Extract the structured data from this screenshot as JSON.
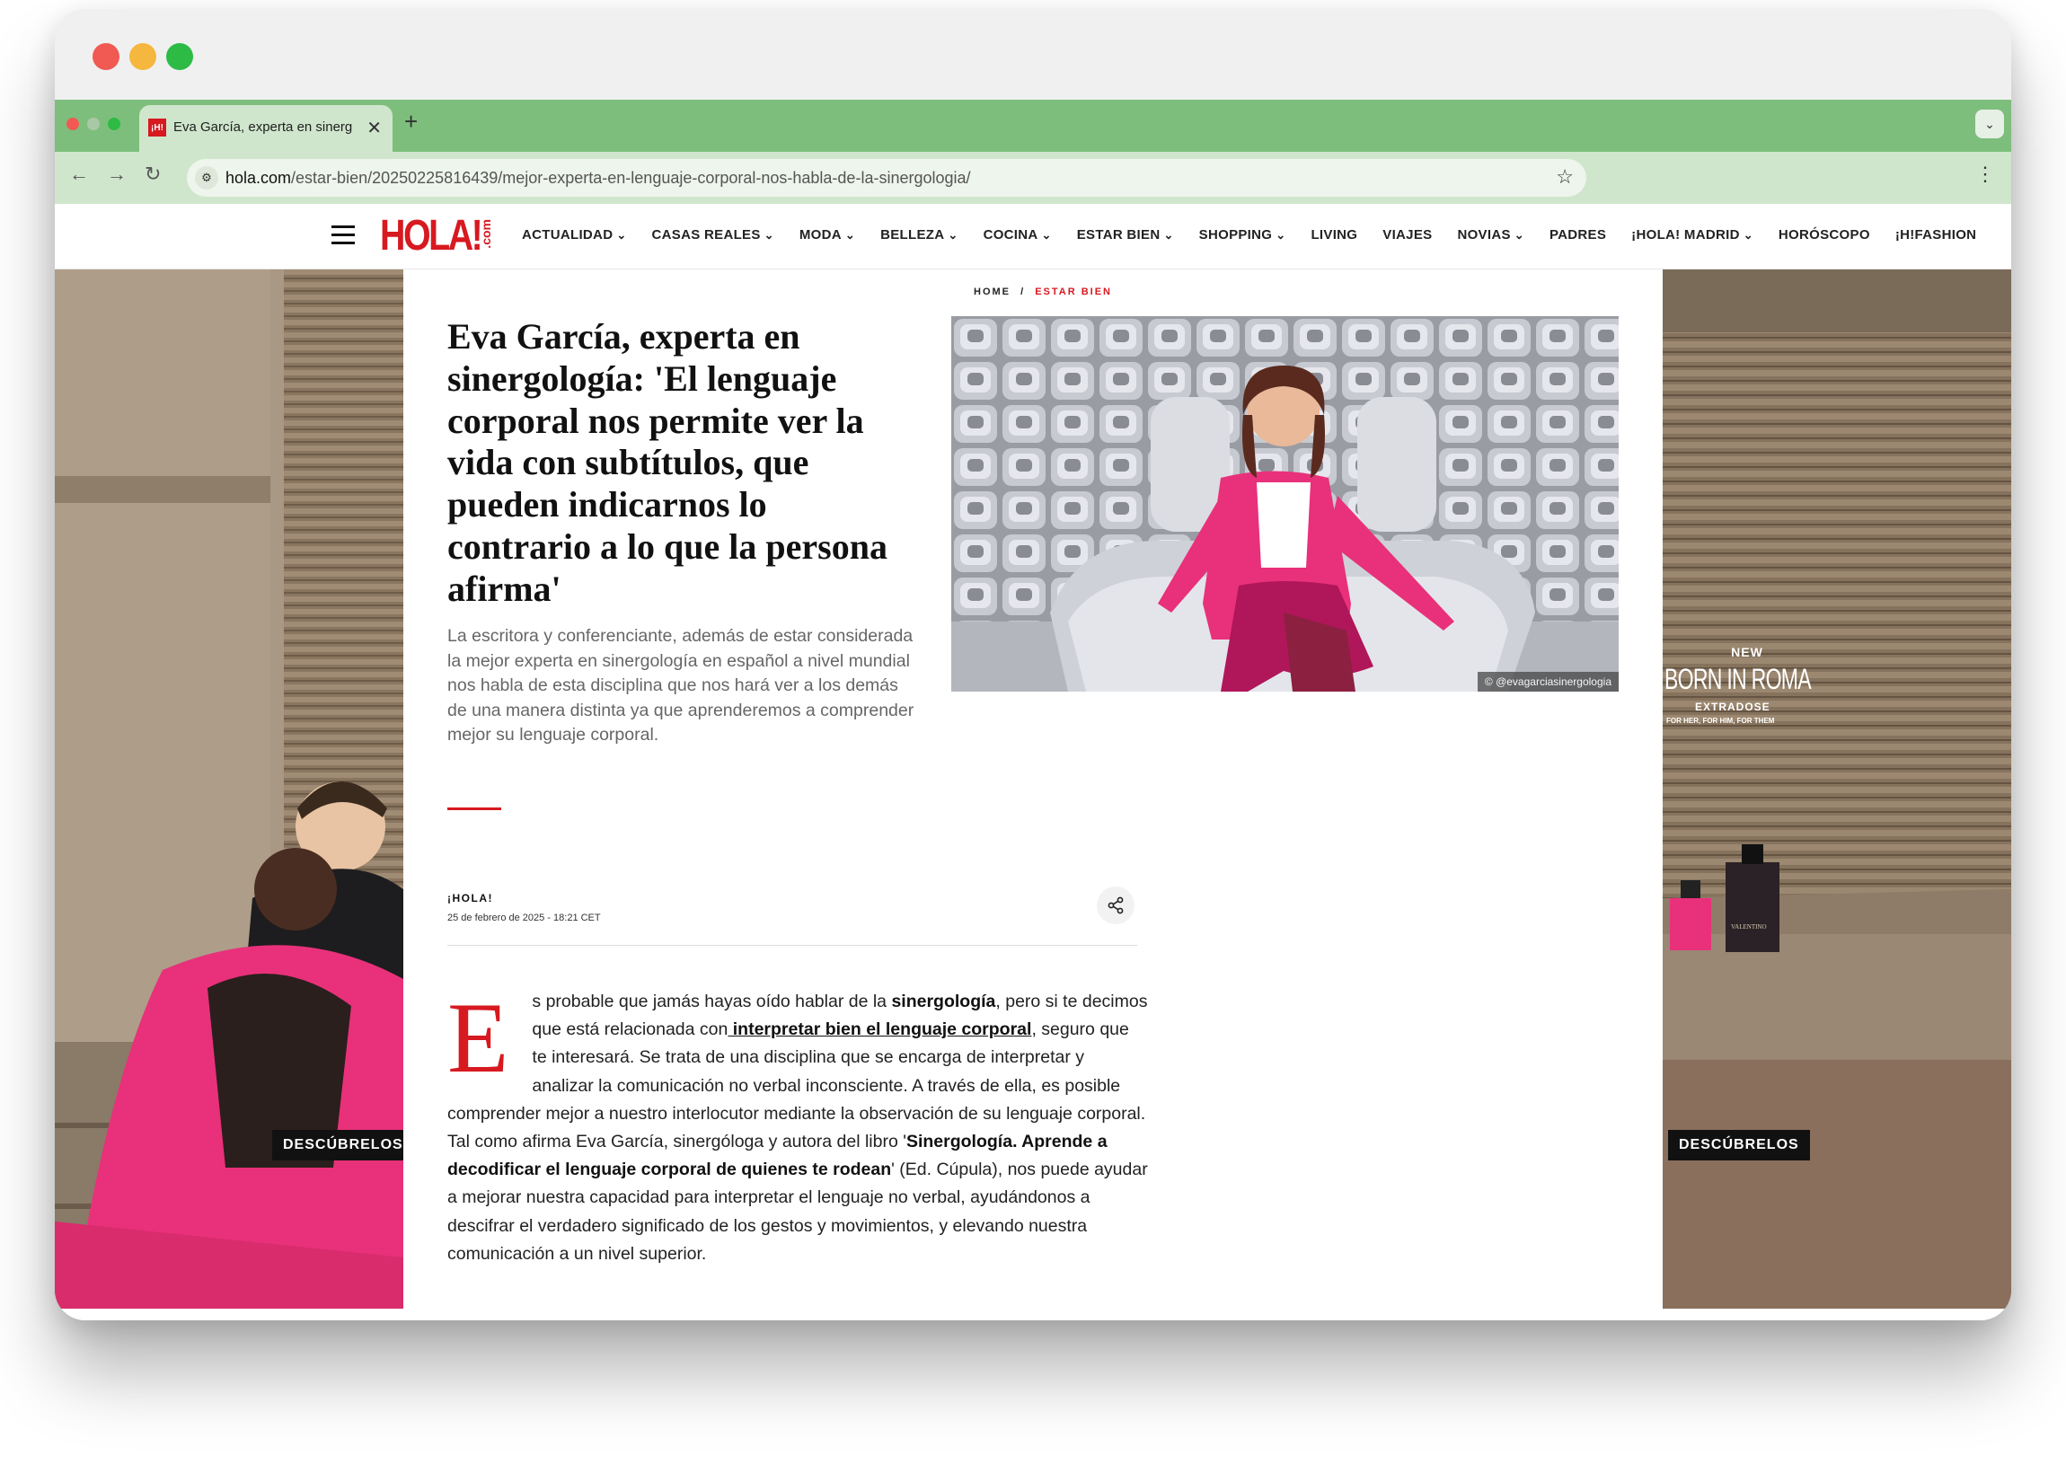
{
  "browser": {
    "tab_title": "Eva García, experta en sinerg",
    "favicon_text": "¡H!",
    "url_domain": "hola.com",
    "url_path": "/estar-bien/20250225816439/mejor-experta-en-lenguaje-corporal-nos-habla-de-la-sinergologia/"
  },
  "site": {
    "logo_text": "HOLA!",
    "logo_suffix": ".com",
    "nav": [
      "ACTUALIDAD",
      "CASAS REALES",
      "MODA",
      "BELLEZA",
      "COCINA",
      "ESTAR BIEN",
      "SHOPPING",
      "LIVING",
      "VIAJES",
      "NOVIAS",
      "PADRES",
      "¡HOLA! MADRID",
      "HORÓSCOPO",
      "¡H!FASHION"
    ],
    "nav_has_dropdown": [
      true,
      true,
      true,
      true,
      true,
      true,
      true,
      false,
      false,
      true,
      false,
      true,
      false,
      false
    ]
  },
  "ads": {
    "cta": "DESCÚBRELOS",
    "right_new": "NEW",
    "right_product": "BORN IN ROMA",
    "right_variant": "EXTRADOSE",
    "right_tagline": "FOR HER, FOR HIM, FOR THEM",
    "bottle_brand": "VALENTINO"
  },
  "article": {
    "breadcrumb_home": "HOME",
    "breadcrumb_sep": "/",
    "breadcrumb_section": "ESTAR BIEN",
    "headline": "Eva García, experta en sinergología: 'El lenguaje corporal nos permite ver la vida con subtítulos, que pueden indicarnos lo contrario a lo que la persona afirma'",
    "dek": "La escritora y conferenciante, además de estar considerada la mejor experta en sinergología en español a nivel mundial nos habla de esta disciplina que nos hará ver a los demás de una manera distinta ya que aprenderemos a comprender mejor su lenguaje corporal.",
    "byline": "¡HOLA!",
    "date": "25 de febrero de 2025 - 18:21 CET",
    "photo_credit": "© @evagarciasinergologia",
    "body": {
      "dropcap": "E",
      "p1": "s probable que jamás hayas oído hablar de la ",
      "b1": "sinergología",
      "p2": ", pero si te decimos que está relacionada con",
      "link": " interpretar bien el lenguaje corporal",
      "p3": ", seguro que te interesará. Se trata de una disciplina que se encarga de interpretar y analizar la comunicación no verbal inconsciente. A través de ella, es posible comprender mejor a nuestro interlocutor mediante la observación de su lenguaje corporal. Tal como afirma Eva García, sinergóloga y autora del libro '",
      "b2": "Sinergología. Aprende a decodificar el lenguaje corporal de quienes te rodean",
      "p4": "' (Ed. Cúpula), nos puede ayudar a mejorar nuestra capacidad para interpretar el lenguaje no verbal, ayudándonos a descifrar el verdadero significado de los gestos y movimientos, y elevando nuestra comunicación a un nivel superior."
    }
  },
  "colors": {
    "brand_red": "#d71920",
    "tabbar_green": "#7dbe7c",
    "toolbar_green": "#cfe6cc",
    "accent_pink": "#e8317a"
  }
}
